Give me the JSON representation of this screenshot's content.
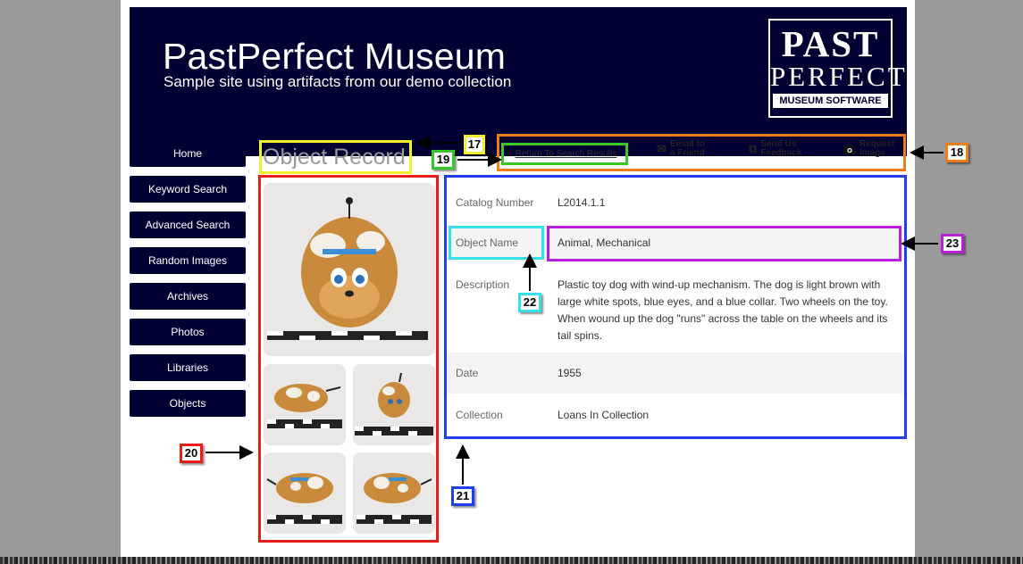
{
  "site": {
    "title": "PastPerfect Museum",
    "subtitle": "Sample site using artifacts from our demo collection",
    "logo": {
      "line1": "PAST",
      "line2": "PERFECT",
      "line3": "MUSEUM SOFTWARE"
    }
  },
  "nav": {
    "items": [
      {
        "label": "Home"
      },
      {
        "label": "Keyword Search"
      },
      {
        "label": "Advanced Search"
      },
      {
        "label": "Random Images"
      },
      {
        "label": "Archives"
      },
      {
        "label": "Photos"
      },
      {
        "label": "Libraries"
      },
      {
        "label": "Objects"
      }
    ]
  },
  "page_title": "Object Record",
  "toolbar": {
    "return_chevron": "<",
    "return_label": "Return To Search Results",
    "email_label_1": "Email to",
    "email_label_2": "a Friend",
    "feedback_label_1": "Send Us",
    "feedback_label_2": "Feedback",
    "request_label_1": "Request",
    "request_label_2": "Image",
    "icons": [
      "envelope-icon",
      "feedback-icon",
      "camera-icon"
    ]
  },
  "record": {
    "catalog_label": "Catalog Number",
    "catalog_value": "L2014.1.1",
    "name_label": "Object Name",
    "name_value": "Animal, Mechanical",
    "desc_label": "Description",
    "desc_value": "Plastic toy dog with wind-up mechanism. The dog is light brown with large white spots, blue eyes, and a blue collar. Two wheels on the toy. When wound up the dog \"runs\" across the table on the wheels and its tail spins.",
    "date_label": "Date",
    "date_value": "1955",
    "collection_label": "Collection",
    "collection_value": "Loans In Collection"
  },
  "callouts": {
    "c17": "17",
    "c18": "18",
    "c19": "19",
    "c20": "20",
    "c21": "21",
    "c22": "22",
    "c23": "23"
  },
  "colors": {
    "navy": "#000033",
    "yellow": "#f2f02a",
    "orange": "#ef7d1a",
    "green": "#36c82b",
    "red": "#ea1c1c",
    "blue": "#1c3ff0",
    "cyan": "#37dfe9",
    "purple": "#b71fd9"
  }
}
